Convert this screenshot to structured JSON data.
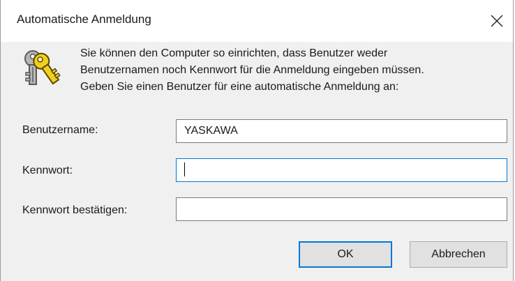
{
  "window": {
    "title": "Automatische Anmeldung",
    "close_icon": "close-icon"
  },
  "message": {
    "icon": "keys-icon",
    "lines": [
      "Sie können den Computer so einrichten, dass Benutzer weder",
      "Benutzernamen noch Kennwort für die Anmeldung eingeben müssen.",
      "Geben Sie einen Benutzer für eine automatische Anmeldung an:"
    ]
  },
  "form": {
    "username": {
      "label": "Benutzername:",
      "value": "YASKAWA"
    },
    "password": {
      "label": "Kennwort:",
      "value": ""
    },
    "confirm": {
      "label": "Kennwort bestätigen:",
      "value": ""
    }
  },
  "buttons": {
    "ok_label": "OK",
    "cancel_label": "Abbrechen"
  },
  "colors": {
    "accent": "#0078d7",
    "dialog_bg": "#f0f0f0",
    "button_bg": "#e1e1e1"
  }
}
